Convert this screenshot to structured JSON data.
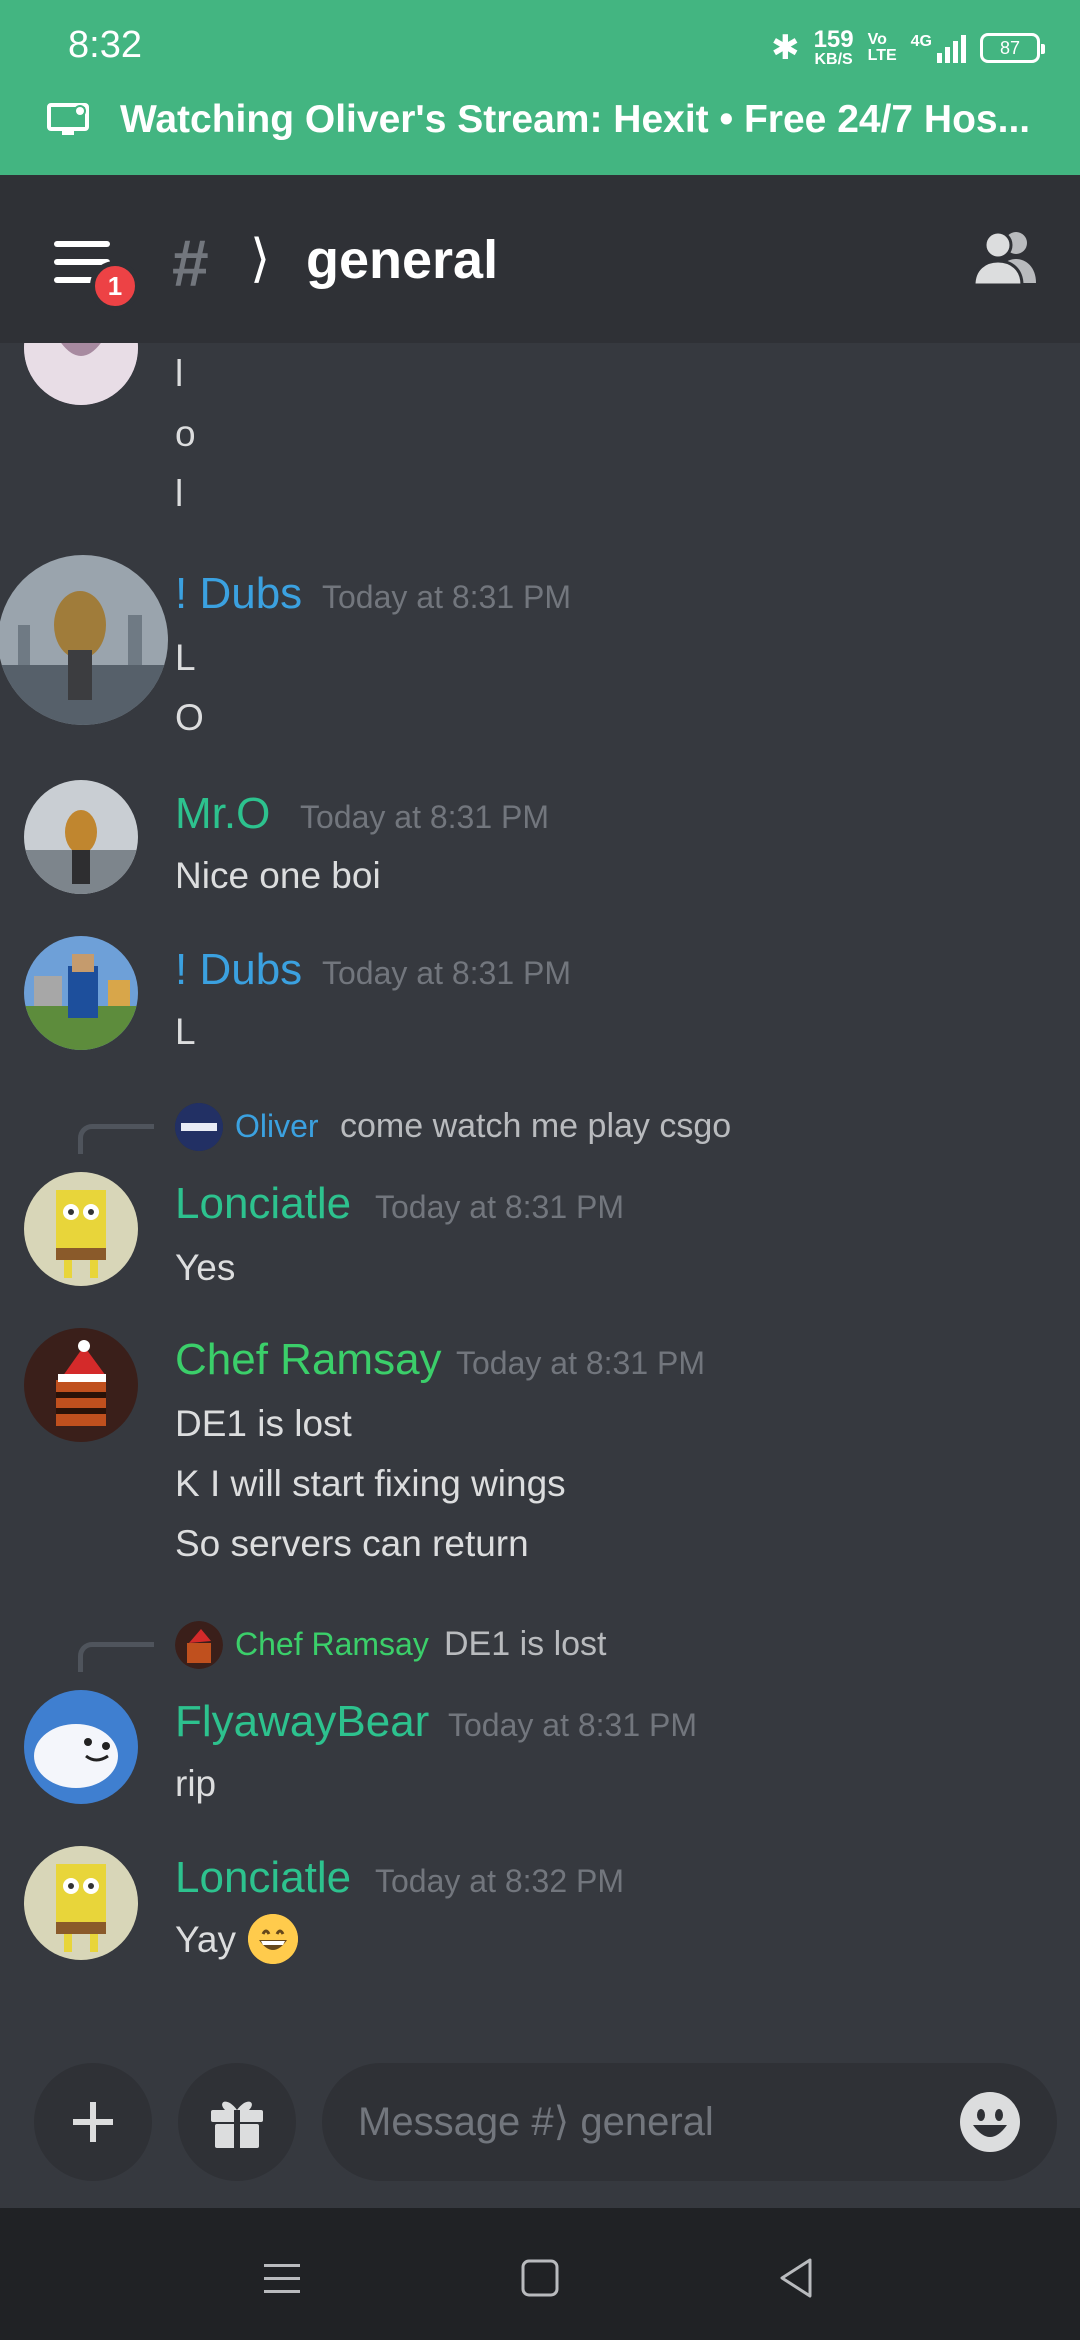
{
  "status_bar": {
    "time": "8:32",
    "net_speed_value": "159",
    "net_speed_unit": "KB/S",
    "volte_top": "Vo",
    "volte_bottom": "LTE",
    "network": "4G",
    "battery": "87"
  },
  "stream_banner": {
    "text": "Watching Oliver's Stream: Hexit • Free 24/7 Hos..."
  },
  "header": {
    "notification_count": "1",
    "hash": "#",
    "chevron": "⟩",
    "channel_name": "general"
  },
  "messages": [
    {
      "author": "",
      "timestamp": "",
      "lines": [
        "l",
        "o",
        "l"
      ]
    },
    {
      "author": "! Dubs",
      "timestamp": "Today at 8:31 PM",
      "lines": [
        "L",
        "O"
      ]
    },
    {
      "author": "Mr.O",
      "timestamp": "Today at 8:31 PM",
      "lines": [
        "Nice one boi"
      ]
    },
    {
      "author": "! Dubs",
      "timestamp": "Today at 8:31 PM",
      "lines": [
        "L"
      ]
    },
    {
      "reply": {
        "author": "Oliver",
        "text": "come watch me play csgo"
      },
      "author": "Lonciatle",
      "timestamp": "Today at 8:31 PM",
      "lines": [
        "Yes"
      ]
    },
    {
      "author": "Chef Ramsay",
      "timestamp": "Today at 8:31 PM",
      "lines": [
        "DE1 is lost",
        "K I will start fixing wings",
        "So servers can return"
      ]
    },
    {
      "reply": {
        "author": "Chef Ramsay",
        "text": "DE1 is lost"
      },
      "author": "FlyawayBear",
      "timestamp": "Today at 8:31 PM",
      "lines": [
        "rip"
      ]
    },
    {
      "author": "Lonciatle",
      "timestamp": "Today at 8:32 PM",
      "lines": [
        "Yay"
      ],
      "emoji": "grinning-face"
    }
  ],
  "composer": {
    "placeholder": "Message #⟩ general"
  },
  "colors": {
    "stream_green": "#43b581",
    "background": "#36393f",
    "header": "#2f3136",
    "name_blue": "#3ba1e0",
    "name_green": "#2dc28e",
    "badge_red": "#ed4245"
  }
}
